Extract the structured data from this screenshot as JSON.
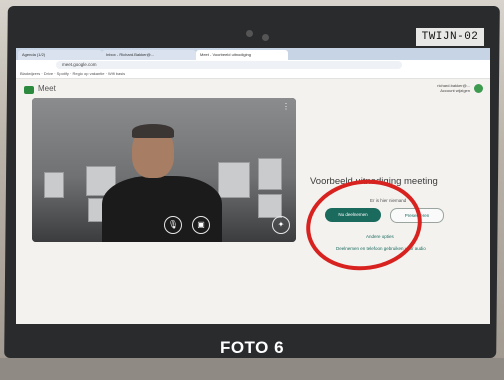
{
  "bezel_label": "TWIJN-02",
  "browser": {
    "tabs": [
      "Agenda (1/2)",
      "Inbox - Richard.Bakker@...",
      "Meet - Voorbeeld uitnodiging"
    ],
    "url": "meet.google.com",
    "bookmarks": "Bladwijzers  ·  Drive  ·  Spotify  ·  Regio op vakantie  ·  Wifi basis"
  },
  "app": {
    "name": "Meet",
    "account_email": "richard.bakker@...",
    "account_switch": "Account wijzigen"
  },
  "join_panel": {
    "title": "Voorbeeld uitnodiging meeting",
    "status": "Er is hier niemand",
    "join_label": "Nu deelnemen",
    "present_label": "Presenteren",
    "other_options": "Andere opties",
    "phone_option": "Deelnemen en telefoon gebruiken voor audio"
  },
  "video_controls": {
    "mic_icon": "microphone-icon",
    "camera_icon": "camera-icon",
    "effects_icon": "effects-icon"
  },
  "caption": "FOTO 6",
  "colors": {
    "highlight_circle": "#d8221f",
    "join_button": "#1a6b5e"
  }
}
